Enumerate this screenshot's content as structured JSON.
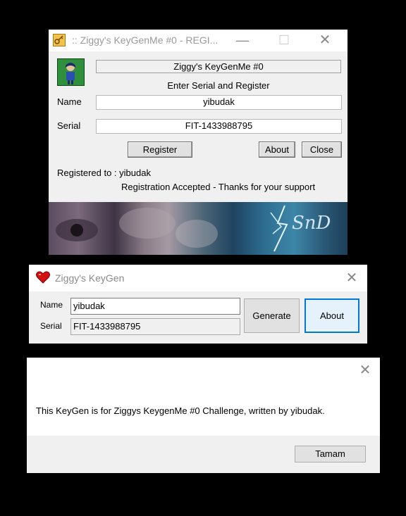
{
  "window1": {
    "title": ":: Ziggy's KeyGenMe #0 - REGI...",
    "header": "Ziggy's KeyGenMe #0",
    "subheader": "Enter Serial and Register",
    "name_label": "Name",
    "name_value": "yibudak",
    "serial_label": "Serial",
    "serial_value": "FIT-1433988795",
    "register_button": "Register",
    "about_button": "About",
    "close_button": "Close",
    "registered_to": "Registered to : yibudak",
    "status": "Registration Accepted - Thanks for your support",
    "banner_text": "SnD"
  },
  "window2": {
    "title": "Ziggy's KeyGen",
    "name_label": "Name",
    "name_value": "yibudak",
    "serial_label": "Serial",
    "serial_value": "FIT-1433988795",
    "generate_button": "Generate",
    "about_button": "About"
  },
  "window3": {
    "message": "This KeyGen is for Ziggys KeygenMe #0 Challenge, written by yibudak.",
    "ok_button": "Tamam"
  },
  "icons": {
    "w1_app_icon": "key-icon",
    "w1_avatar": "character-avatar",
    "w2_app_icon": "heart-icon"
  }
}
